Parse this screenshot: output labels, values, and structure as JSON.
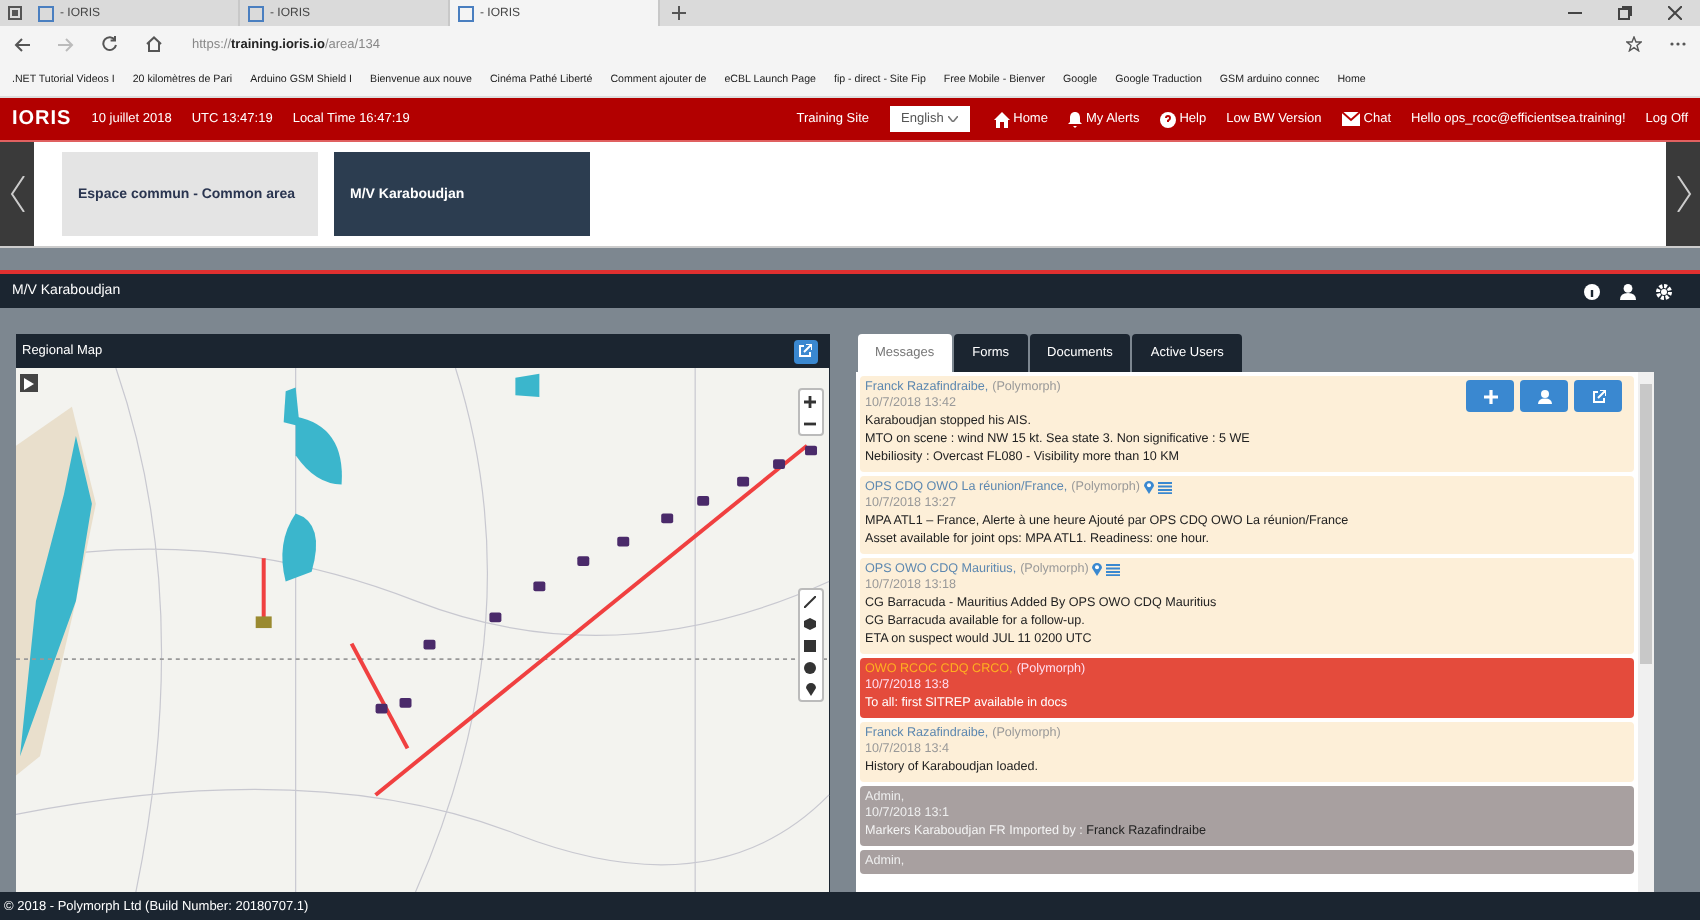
{
  "browser": {
    "tabs": [
      {
        "title": "- IORIS",
        "selected": false
      },
      {
        "title": "- IORIS",
        "selected": false
      },
      {
        "title": "- IORIS",
        "selected": true
      }
    ],
    "url_prefix": "https://",
    "url_host": "training.ioris.io",
    "url_path": "/area/134",
    "bookmarks": [
      ".NET Tutorial Videos I",
      "20 kilomètres de Pari",
      "Arduino GSM Shield I",
      "Bienvenue aux nouve",
      "Cinéma Pathé Liberté",
      "Comment  ajouter de",
      "eCBL Launch Page",
      "fip - direct - Site Fip",
      "Free Mobile - Bienver",
      "Google",
      "Google Traduction",
      "GSM arduino connec",
      "Home"
    ]
  },
  "header": {
    "logo": "IORIS",
    "date": "10 juillet 2018",
    "utc": "UTC 13:47:19",
    "local": "Local Time 16:47:19",
    "site": "Training Site",
    "language": "English",
    "nav": [
      {
        "label": "Home"
      },
      {
        "label": "My Alerts"
      },
      {
        "label": "Help"
      },
      {
        "label": "Low BW Version"
      },
      {
        "label": "Chat"
      }
    ],
    "greeting": "Hello ops_rcoc@efficientsea.training!",
    "logout": "Log Off"
  },
  "areas": [
    {
      "label": "Espace commun - Common area",
      "selected": false
    },
    {
      "label": "M/V Karaboudjan",
      "selected": true
    }
  ],
  "panel": {
    "title": "M/V Karaboudjan",
    "map": {
      "title": "Regional Map"
    },
    "tabs": [
      {
        "label": "Messages",
        "selected": true
      },
      {
        "label": "Forms",
        "selected": false
      },
      {
        "label": "Documents",
        "selected": false
      },
      {
        "label": "Active Users",
        "selected": false
      }
    ],
    "messages": [
      {
        "kind": "normal",
        "author": "Franck Razafindraibe,",
        "org": "(Polymorph)",
        "time": "10/7/2018 13:42",
        "located": false,
        "lines": [
          "Karaboudjan stopped his AIS.",
          "MTO on scene : wind NW 15 kt. Sea state 3. Non significative : 5 WE",
          "Nebiliosity : Overcast FL080 - Visibility more than 10 KM"
        ]
      },
      {
        "kind": "normal",
        "author": "OPS CDQ OWO La réunion/France,",
        "org": "(Polymorph)",
        "time": "10/7/2018 13:27",
        "located": true,
        "lines": [
          "MPA ATL1 – France, Alerte à une heure Ajouté par OPS CDQ OWO La réunion/France",
          "Asset available for joint ops: MPA ATL1. Readiness: one hour."
        ]
      },
      {
        "kind": "normal",
        "author": "OPS OWO CDQ Mauritius,",
        "org": "(Polymorph)",
        "time": "10/7/2018 13:18",
        "located": true,
        "lines": [
          "CG Barracuda - Mauritius Added By OPS OWO CDQ Mauritius",
          "CG Barracuda available for a follow-up.",
          "ETA on suspect would JUL 11 0200 UTC"
        ]
      },
      {
        "kind": "alert",
        "author": "OWO RCOC CDQ CRCO,",
        "org": "(Polymorph)",
        "time": "10/7/2018 13:8",
        "located": false,
        "lines": [
          "To all: first SITREP available in docs"
        ]
      },
      {
        "kind": "normal",
        "author": "Franck Razafindraibe,",
        "org": "(Polymorph)",
        "time": "10/7/2018 13:4",
        "located": false,
        "lines": [
          "History of Karaboudjan loaded."
        ]
      },
      {
        "kind": "system",
        "author": "Admin,",
        "time": "10/7/2018 13:1",
        "located": false,
        "lines": [
          "Markers Karaboudjan FR Imported by :"
        ],
        "mention": "Franck Razafindraibe"
      },
      {
        "kind": "system",
        "author": "Admin,",
        "located": false
      }
    ]
  },
  "footer": "© 2018 - Polymorph Ltd (Build Number: 20180707.1)"
}
